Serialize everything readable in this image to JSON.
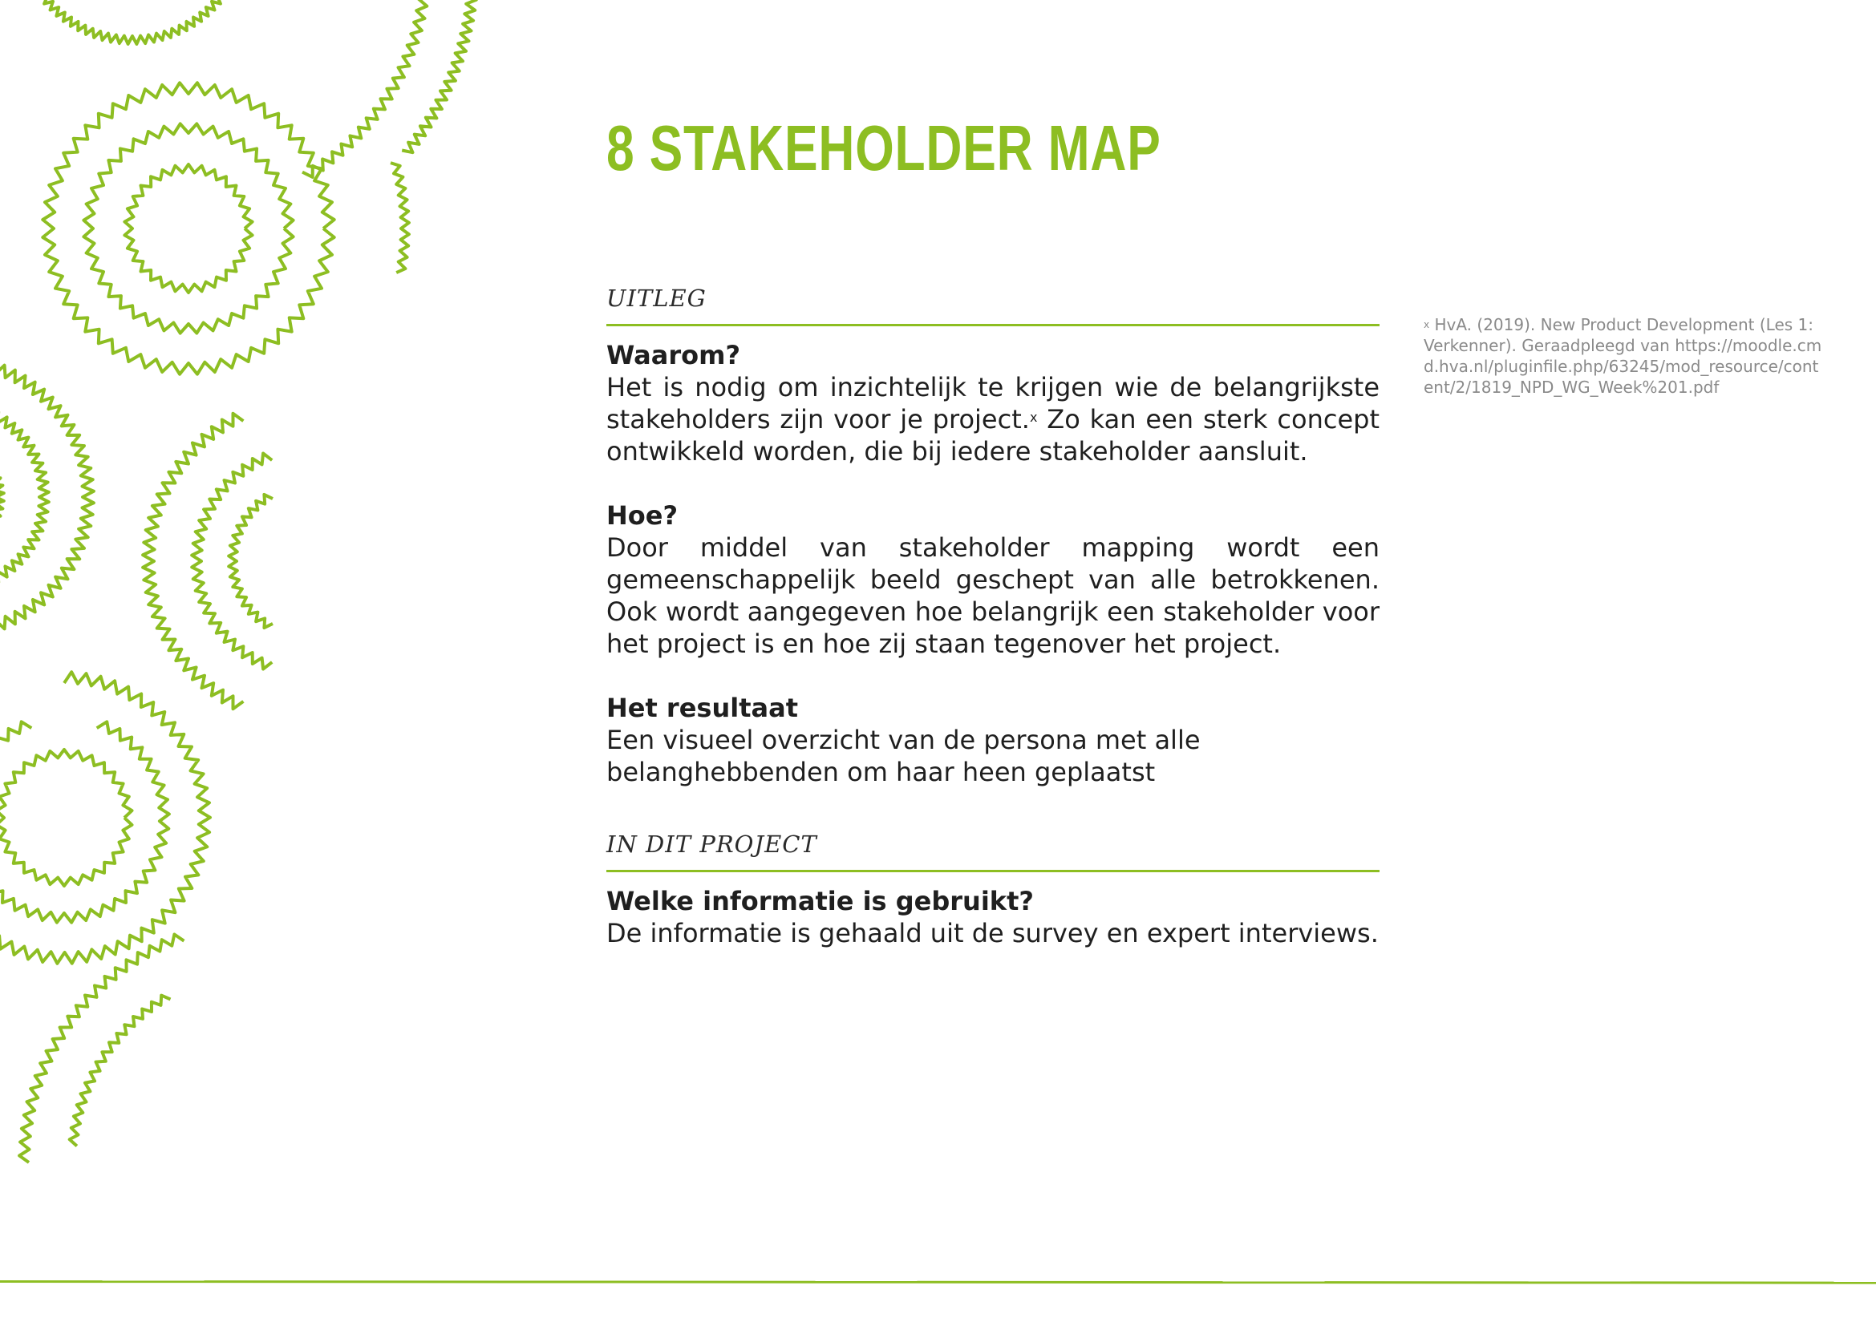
{
  "title": "8 STAKEHOLDER MAP",
  "uitleg": {
    "heading": "UITLEG",
    "waarom": {
      "question": "Waarom?",
      "answer_before": "Het is nodig om inzichtelijk te krijgen wie de belangrijkste stakeholders zijn voor je project.",
      "footnote_marker": "x",
      "answer_after": " Zo kan een sterk concept ontwikkeld worden, die bij iedere stakeholder aansluit."
    },
    "hoe": {
      "question": "Hoe?",
      "answer": "Door middel van stakeholder mapping wordt een gemeenschappelijk beeld geschept van alle betrokkenen. Ook wordt aangegeven hoe belangrijk een stakeholder voor het project is en hoe zij staan tegenover het project."
    },
    "resultaat": {
      "question": "Het resultaat",
      "answer": "Een visueel overzicht van de persona met alle belanghebbenden om haar heen geplaatst"
    }
  },
  "project": {
    "heading": "IN DIT PROJECT",
    "info": {
      "question": "Welke informatie is gebruikt?",
      "answer": "De informatie is gehaald uit de survey en expert interviews."
    }
  },
  "footnote": {
    "marker": "x",
    "text": " HvA. (2019). New Product Development (Les 1: Verkenner). Geraadpleegd van https://moodle.cmd.hva.nl/pluginfile.php/63245/mod_resource/content/2/1819_NPD_WG_Week%201.pdf"
  },
  "colors": {
    "accent": "#8dbe22",
    "text": "#1f1f1f",
    "footnote": "#8a8a8a"
  }
}
